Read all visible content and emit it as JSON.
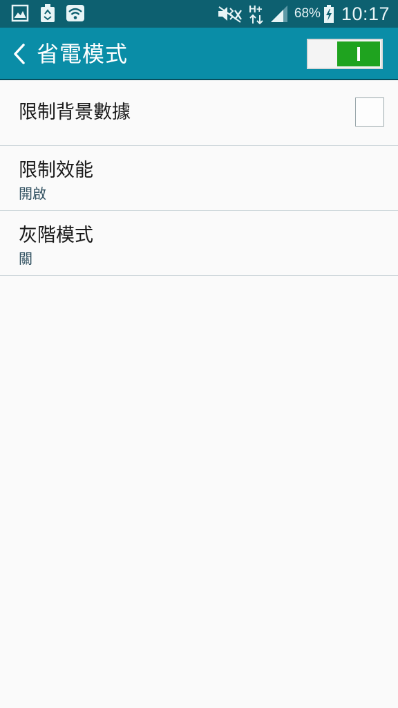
{
  "status_bar": {
    "icons_left": [
      "gallery-icon",
      "recycle-icon",
      "wifi-icon"
    ],
    "icons_right": [
      "mute-icon",
      "h-plus-data-icon",
      "signal-icon",
      "battery-charging-icon"
    ],
    "battery_percent": "68%",
    "clock": "10:17"
  },
  "action_bar": {
    "title": "省電模式",
    "master_switch_on": true
  },
  "settings": {
    "items": [
      {
        "title": "限制背景數據",
        "summary": "",
        "control": "checkbox",
        "checked": false
      },
      {
        "title": "限制效能",
        "summary": "開啟"
      },
      {
        "title": "灰階模式",
        "summary": "關"
      }
    ]
  },
  "colors": {
    "status_bar": "#0d6070",
    "action_bar": "#0a8da7",
    "switch_on": "#1fa31f",
    "background": "#fafafa"
  }
}
